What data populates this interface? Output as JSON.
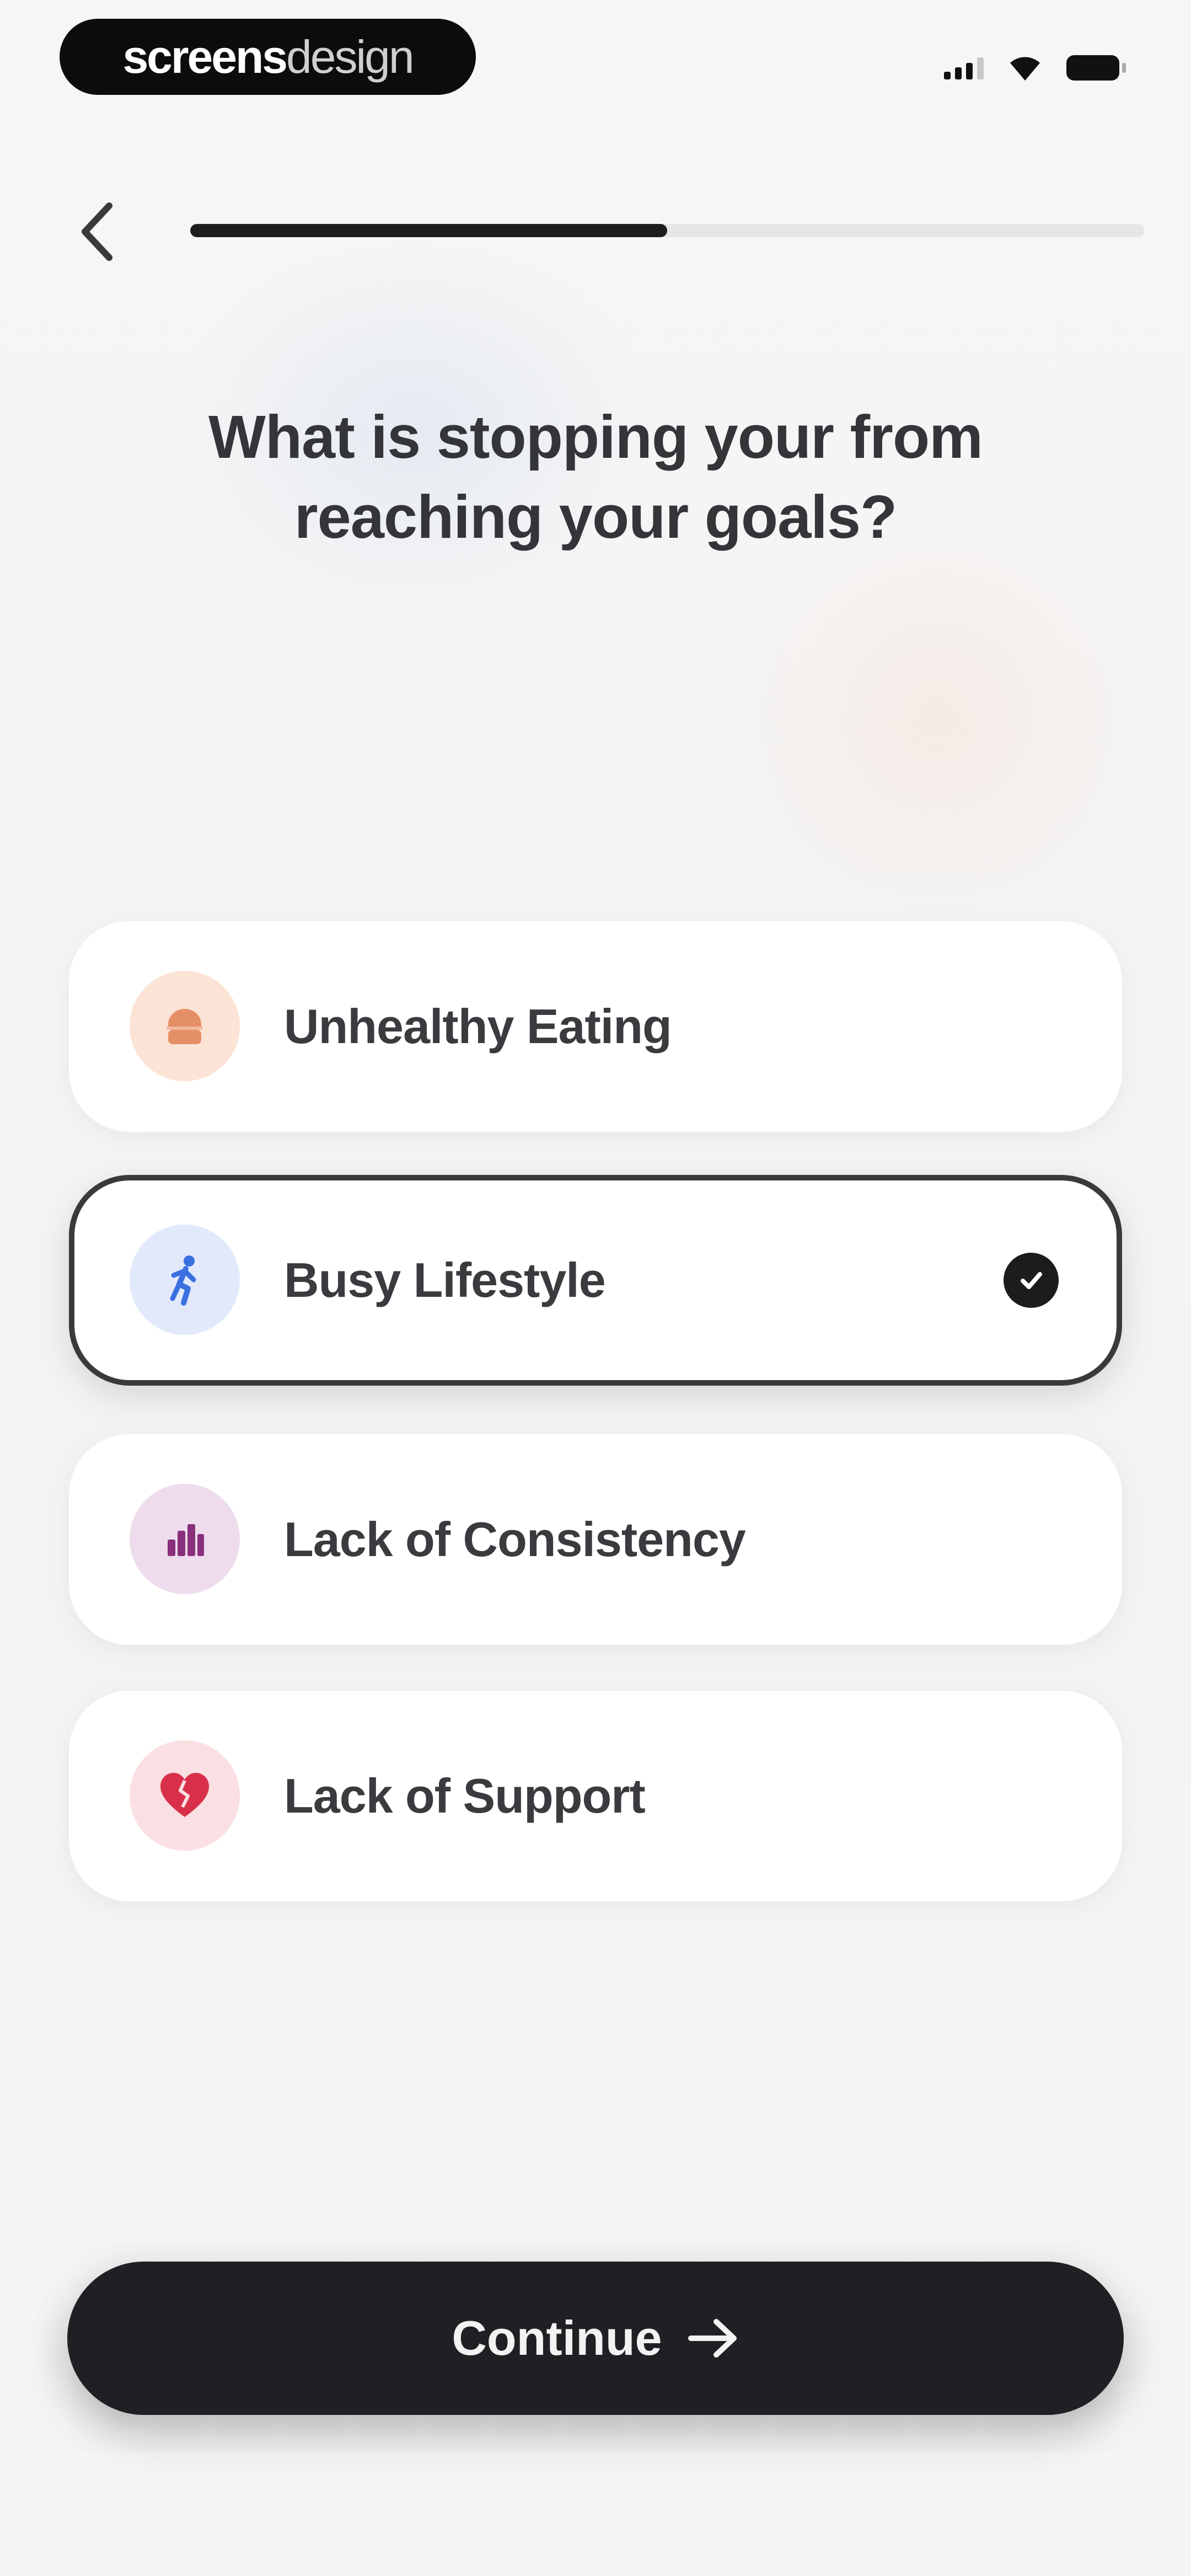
{
  "status_bar": {
    "brand_bold": "screens",
    "brand_light": "design",
    "icons": [
      "cellular-signal-icon",
      "wifi-icon",
      "battery-icon"
    ]
  },
  "header": {
    "back_icon": "chevron-left-icon",
    "progress_fraction": 0.5
  },
  "question": {
    "line1": "What is stopping your from",
    "line2": "reaching your goals?"
  },
  "options": [
    {
      "label": "Unhealthy Eating",
      "icon": "food-icon",
      "icon_bg": "#fbe3d6",
      "icon_color": "#e58f66",
      "selected": false
    },
    {
      "label": "Busy Lifestyle",
      "icon": "running-person-icon",
      "icon_bg": "#e1e9fb",
      "icon_color": "#3a6fe0",
      "selected": true
    },
    {
      "label": "Lack of Consistency",
      "icon": "bar-chart-icon",
      "icon_bg": "#eedcec",
      "icon_color": "#8a2f7c",
      "selected": false
    },
    {
      "label": "Lack of Support",
      "icon": "broken-heart-icon",
      "icon_bg": "#fae0e3",
      "icon_color": "#d8304a",
      "selected": false
    }
  ],
  "continue_button": {
    "label": "Continue",
    "icon": "arrow-right-icon"
  },
  "colors": {
    "primary_dark": "#1e2023",
    "background": "#f4f4f4"
  }
}
